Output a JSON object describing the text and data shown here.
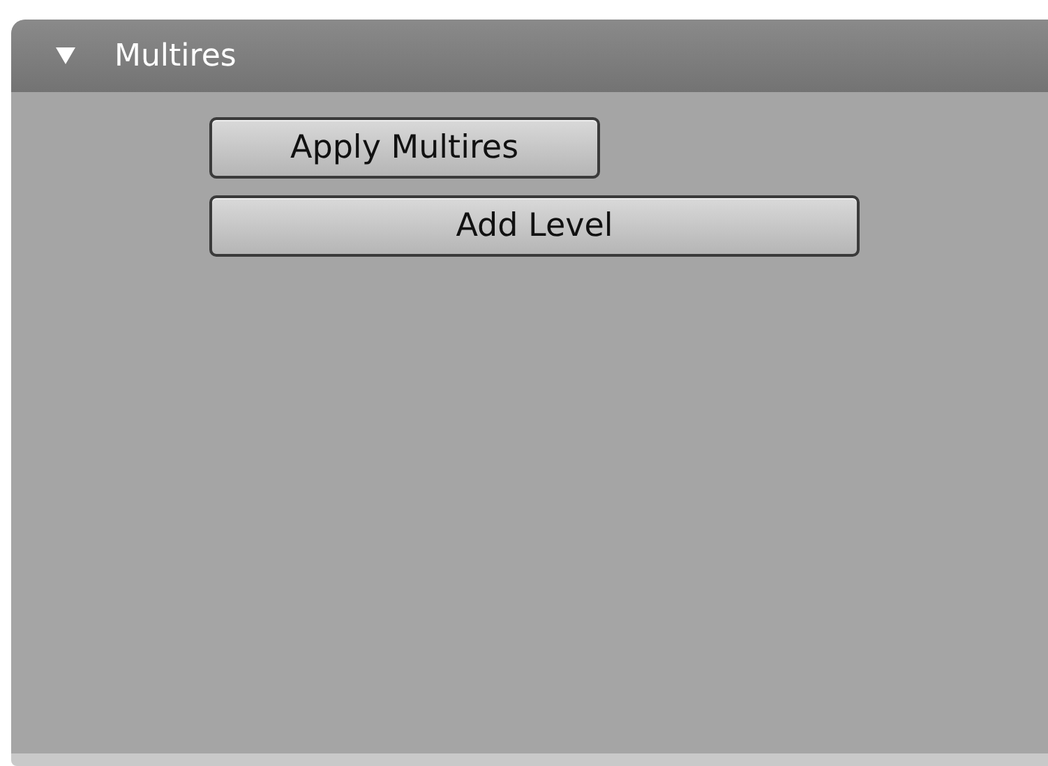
{
  "panel": {
    "title": "Multires",
    "expanded": true
  },
  "buttons": [
    {
      "label": "Apply Multires"
    },
    {
      "label": "Add Level"
    }
  ]
}
